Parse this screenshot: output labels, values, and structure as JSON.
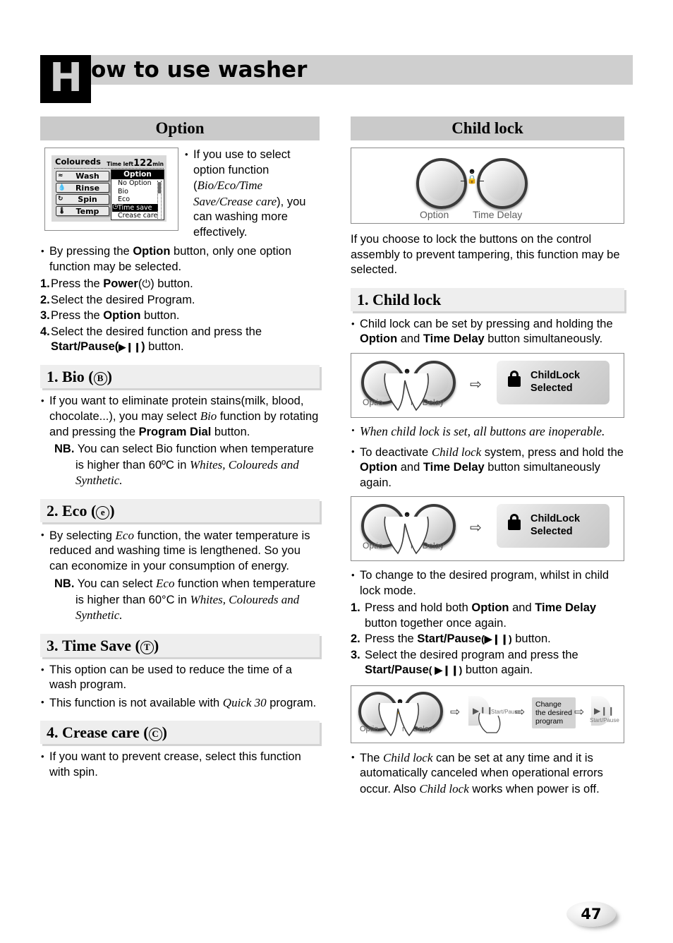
{
  "header": {
    "drop_cap": "H",
    "title": "ow to use washer"
  },
  "left_column": {
    "section_title": "Option",
    "lcd": {
      "program": "Coloureds",
      "time_left_label": "Time left",
      "time_left_value": "122",
      "time_left_unit": "min",
      "menu": [
        {
          "icon": "wash-icon",
          "glyph": "≈",
          "label": "Wash"
        },
        {
          "icon": "rinse-icon",
          "glyph": "💧",
          "label": "Rinse"
        },
        {
          "icon": "spin-icon",
          "glyph": "↻",
          "label": "Spin"
        },
        {
          "icon": "temp-icon",
          "glyph": "🌡",
          "label": "Temp"
        }
      ],
      "option_panel_title": "Option",
      "option_items": [
        "No Option",
        "Bio",
        "Eco",
        "Time save",
        "Crease care"
      ],
      "option_selected": "Time save"
    },
    "intro_bullet": "If you use to select option function (",
    "intro_italic": "Bio/Eco/Time Save/Crease care",
    "intro_bullet_end": "), you can washing more effectively.",
    "bullet_option": {
      "pre": "By pressing the ",
      "bold1": "Option",
      "post": " button, only one option function may be selected."
    },
    "steps": [
      {
        "n": "1.",
        "pre": "Press the ",
        "bold": "Power",
        "paren_open": "(",
        "sym": "⏻",
        "paren_close": ")",
        "post": " button."
      },
      {
        "n": "2.",
        "pre": "Select the desired Program.",
        "bold": "",
        "post": ""
      },
      {
        "n": "3.",
        "pre": "Press the ",
        "bold": "Option",
        "post": " button."
      },
      {
        "n": "4.",
        "pre": "Select the desired function and press the ",
        "bold": "Start/Pause",
        "paren_open": "(",
        "sym": "▶❙❙",
        "paren_close": ")",
        "post": " button."
      }
    ],
    "sections": [
      {
        "heading_num": "1.",
        "heading_text": "Bio",
        "symbol": "B",
        "body_pre": "If you want to eliminate protein stains(milk, blood, chocolate...), you may select ",
        "body_italic": "Bio",
        "body_post": " function by rotating and pressing the ",
        "body_bold": "Program Dial",
        "body_tail": " button.",
        "nb_label": "NB.",
        "nb_text": " You can select Bio function when temperature is higher than 60ºC in ",
        "nb_italic": "Whites, Coloureds and Synthetic."
      },
      {
        "heading_num": "2.",
        "heading_text": "Eco",
        "symbol": "e",
        "body_pre": "By selecting ",
        "body_italic": "Eco",
        "body_post": " function, the water temperature is reduced and washing time is lengthened. So you can economize in your consumption of energy.",
        "nb_label": "NB.",
        "nb_pre": " You can select ",
        "nb_italic1": "Eco",
        "nb_post": " function when temperature is higher than 60°C in ",
        "nb_italic2": "Whites, Coloureds and Synthetic."
      },
      {
        "heading_num": "3.",
        "heading_text": "Time Save",
        "symbol": "T",
        "bullet1": "This option can be used to reduce the time of a wash program.",
        "bullet2_pre": "This function is not available with ",
        "bullet2_italic": "Quick 30",
        "bullet2_post": " program."
      },
      {
        "heading_num": "4.",
        "heading_text": "Crease care",
        "symbol": "C",
        "bullet1": "If you want to prevent crease, select this function with spin."
      }
    ]
  },
  "right_column": {
    "section_title": "Child lock",
    "buttons_diagram": {
      "option_label": "Option",
      "time_delay_label": "Time Delay",
      "child_icon": "child-lock-icon"
    },
    "intro": "If you choose to lock the buttons on the control assembly to prevent tampering, this function may be selected.",
    "sub_heading": {
      "num": "1.",
      "text": "Child lock"
    },
    "set_bullet": {
      "pre": "Child lock can be set by pressing and holding the ",
      "bold1": "Option",
      "mid": " and ",
      "bold2": "Time Delay",
      "post": " button simultaneously."
    },
    "childlock_chip": {
      "line1": "ChildLock",
      "line2": "Selected"
    },
    "italic_note": "When child lock is set, all buttons are inoperable.",
    "deactivate_bullet": {
      "pre": "To deactivate ",
      "italic": "Child lock",
      "mid": " system, press and hold the ",
      "bold1": "Option",
      "mid2": " and ",
      "bold2": "Time Delay",
      "post": " button simultaneously again."
    },
    "change_bullet": "To change to the desired program, whilst in child lock mode.",
    "change_steps": [
      {
        "n": "1.",
        "pre": "Press and hold both ",
        "bold1": "Option",
        "mid": " and ",
        "bold2": "Time Delay",
        "post": " button together once again."
      },
      {
        "n": "2.",
        "pre": "Press the ",
        "bold1": "Start/Pause",
        "sym": "(▶❙❙)",
        "post": " button."
      },
      {
        "n": "3.",
        "pre": "Select the desired program and press the ",
        "bold1": "Start/Pause",
        "sym": "( ▶❙❙)",
        "post": " button again."
      }
    ],
    "sequence_diagram": {
      "option_label": "Optio",
      "time_delay_label": "ne Delay",
      "start_pause_label": "Start/Pause",
      "change_chip": "Change the desired program",
      "arrow": "⇨"
    },
    "final_bullet": {
      "pre": "The ",
      "italic1": "Child lock",
      "mid": " can be set at any time and it is automatically canceled when operational errors occur. Also ",
      "italic2": "Child lock",
      "post": " works when power is off."
    }
  },
  "page_number": "47"
}
